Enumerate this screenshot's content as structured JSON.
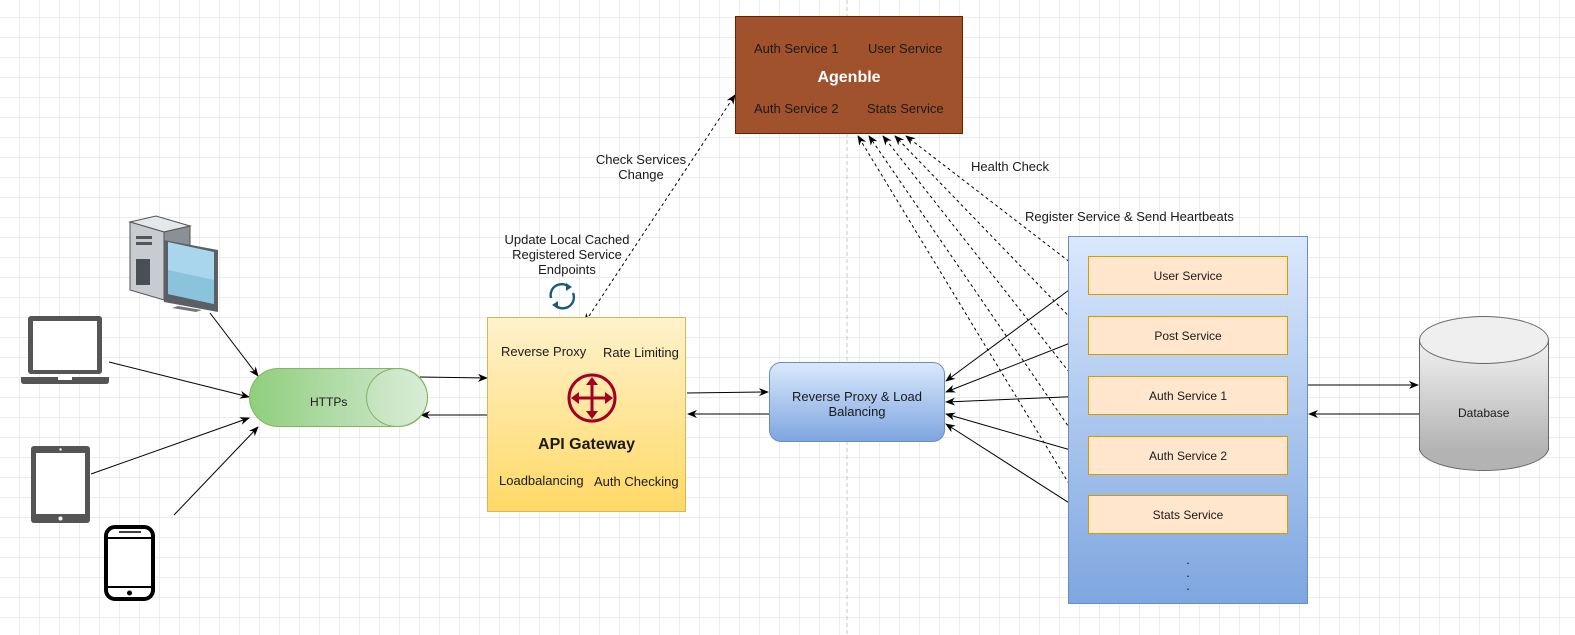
{
  "agenble": {
    "title": "Agenble",
    "items": [
      "Auth Service 1",
      "User Service",
      "Auth Service 2",
      "Stats Service"
    ],
    "fill_color": "#a0522d"
  },
  "annotations": {
    "check_services": [
      "Check Services",
      "Change"
    ],
    "update_cache": [
      "Update Local Cached",
      "Registered Service",
      "Endpoints"
    ],
    "health_check": "Health Check",
    "register_service": "Register Service & Send Heartbeats"
  },
  "clients": [
    {
      "name": "desktop-computer"
    },
    {
      "name": "laptop"
    },
    {
      "name": "tablet"
    },
    {
      "name": "smartphone"
    }
  ],
  "https": {
    "label": "HTTPs",
    "fill_color": "#8fcf7c"
  },
  "api_gateway": {
    "title": "API Gateway",
    "features": [
      "Reverse Proxy",
      "Rate Limiting",
      "Loadbalancing",
      "Auth Checking"
    ],
    "icon": "move-arrows-icon",
    "icon_color": "#a20025"
  },
  "reverse_proxy": {
    "label_line1": "Reverse Proxy & Load",
    "label_line2": "Balancing"
  },
  "services": {
    "items": [
      "User Service",
      "Post Service",
      "Auth Service 1",
      "Auth Service 2",
      "Stats Service"
    ],
    "more": "·\n·\n·"
  },
  "database": {
    "label": "Database"
  }
}
